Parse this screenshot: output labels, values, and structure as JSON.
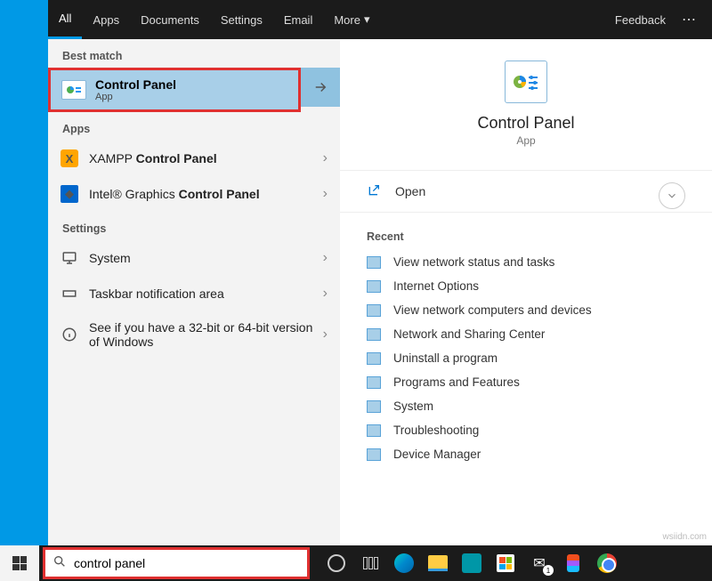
{
  "tabs": {
    "all": "All",
    "apps": "Apps",
    "documents": "Documents",
    "settings": "Settings",
    "email": "Email",
    "more": "More",
    "feedback": "Feedback"
  },
  "best_match_label": "Best match",
  "best_match": {
    "title": "Control Panel",
    "sub": "App"
  },
  "apps_label": "Apps",
  "apps_list": [
    {
      "label": "XAMPP Control Panel"
    },
    {
      "label": "Intel® Graphics Control Panel"
    }
  ],
  "settings_label": "Settings",
  "settings_list": [
    {
      "label": "System"
    },
    {
      "label": "Taskbar notification area"
    },
    {
      "label": "See if you have a 32-bit or 64-bit version of Windows"
    }
  ],
  "detail": {
    "title": "Control Panel",
    "sub": "App",
    "open": "Open",
    "recent_label": "Recent",
    "recent": [
      "View network status and tasks",
      "Internet Options",
      "View network computers and devices",
      "Network and Sharing Center",
      "Uninstall a program",
      "Programs and Features",
      "System",
      "Troubleshooting",
      "Device Manager"
    ]
  },
  "search": {
    "value": "control panel"
  },
  "mail_badge": "1",
  "watermark": "wsiidn.com"
}
